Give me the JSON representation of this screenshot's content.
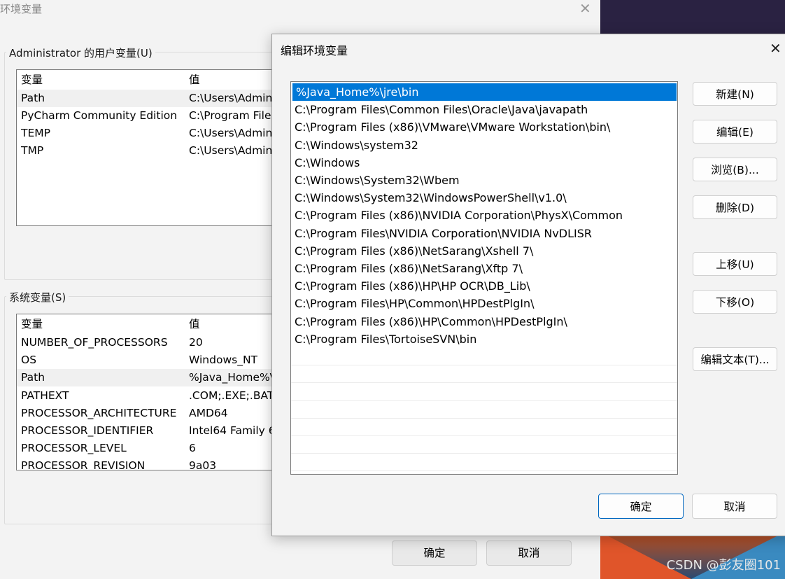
{
  "background_window": {
    "title": "环境变量",
    "user_vars": {
      "group_title": "Administrator 的用户变量(U)",
      "headers": [
        "变量",
        "值"
      ],
      "rows": [
        [
          "Path",
          "C:\\Users\\Admin"
        ],
        [
          "PyCharm Community Edition",
          "C:\\Program File"
        ],
        [
          "TEMP",
          "C:\\Users\\Admin"
        ],
        [
          "TMP",
          "C:\\Users\\Admin"
        ]
      ]
    },
    "system_vars": {
      "group_title": "系统变量(S)",
      "headers": [
        "变量",
        "值"
      ],
      "rows": [
        [
          "NUMBER_OF_PROCESSORS",
          "20"
        ],
        [
          "OS",
          "Windows_NT"
        ],
        [
          "Path",
          "%Java_Home%\\"
        ],
        [
          "PATHEXT",
          ".COM;.EXE;.BAT"
        ],
        [
          "PROCESSOR_ARCHITECTURE",
          "AMD64"
        ],
        [
          "PROCESSOR_IDENTIFIER",
          "Intel64 Family 6"
        ],
        [
          "PROCESSOR_LEVEL",
          "6"
        ],
        [
          "PROCESSOR_REVISION",
          "9a03"
        ]
      ]
    },
    "ok_label": "确定",
    "cancel_label": "取消"
  },
  "dialog": {
    "title": "编辑环境变量",
    "paths": [
      "%Java_Home%\\jre\\bin",
      "C:\\Program Files\\Common Files\\Oracle\\Java\\javapath",
      "C:\\Program Files (x86)\\VMware\\VMware Workstation\\bin\\",
      "C:\\Windows\\system32",
      "C:\\Windows",
      "C:\\Windows\\System32\\Wbem",
      "C:\\Windows\\System32\\WindowsPowerShell\\v1.0\\",
      "C:\\Program Files (x86)\\NVIDIA Corporation\\PhysX\\Common",
      "C:\\Program Files\\NVIDIA Corporation\\NVIDIA NvDLISR",
      "C:\\Program Files (x86)\\NetSarang\\Xshell 7\\",
      "C:\\Program Files (x86)\\NetSarang\\Xftp 7\\",
      "C:\\Program Files (x86)\\HP\\HP OCR\\DB_Lib\\",
      "C:\\Program Files\\HP\\Common\\HPDestPlgIn\\",
      "C:\\Program Files (x86)\\HP\\Common\\HPDestPlgIn\\",
      "C:\\Program Files\\TortoiseSVN\\bin"
    ],
    "selected_index": 0,
    "buttons": {
      "new": "新建(N)",
      "edit": "编辑(E)",
      "browse": "浏览(B)...",
      "delete": "删除(D)",
      "move_up": "上移(U)",
      "move_down": "下移(O)",
      "edit_text": "编辑文本(T)...",
      "ok": "确定",
      "cancel": "取消"
    }
  },
  "watermark": "CSDN @彭友圈101",
  "colors": {
    "selection": "#0078d7",
    "ok_border": "#0067c0"
  }
}
